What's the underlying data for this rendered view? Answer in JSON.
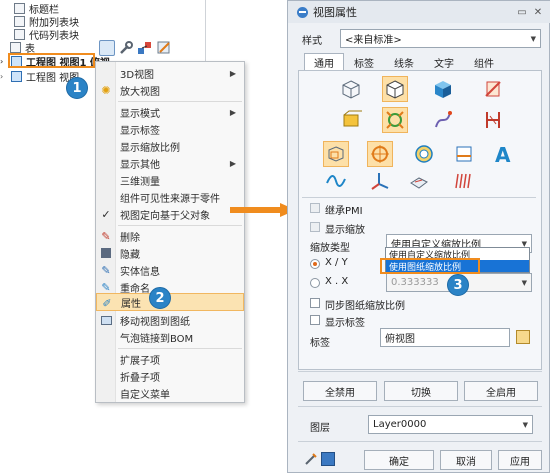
{
  "tree": {
    "items": [
      {
        "label": "标题栏"
      },
      {
        "label": "附加列表块"
      },
      {
        "label": "代码列表块"
      },
      {
        "label": "表"
      },
      {
        "label": "工程图 视图1 俯视"
      },
      {
        "label": "工程图 视图"
      }
    ]
  },
  "context_menu": {
    "items": [
      {
        "label": "3D视图",
        "submenu": true
      },
      {
        "label": "放大视图"
      },
      {
        "label": "显示模式",
        "submenu": true
      },
      {
        "label": "显示标签"
      },
      {
        "label": "显示缩放比例"
      },
      {
        "label": "显示其他",
        "submenu": true
      },
      {
        "label": "三维测量"
      },
      {
        "label": "组件可见性来源于零件"
      },
      {
        "label": "视图定向基于父对象"
      },
      {
        "label": "删除"
      },
      {
        "label": "隐藏"
      },
      {
        "label": "实体信息"
      },
      {
        "label": "重命名"
      },
      {
        "label": "属性"
      },
      {
        "label": "移动视图到图纸"
      },
      {
        "label": "气泡链接到BOM"
      },
      {
        "label": "扩展子项"
      },
      {
        "label": "折叠子项"
      },
      {
        "label": "自定义菜单"
      }
    ]
  },
  "badges": {
    "one": "1",
    "two": "2",
    "three": "3"
  },
  "dialog": {
    "title": "视图属性",
    "style_label": "样式",
    "style_value": "<来自标准>",
    "tabs": [
      "通用",
      "标签",
      "线条",
      "文字",
      "组件"
    ],
    "inherit_pmi": "继承PMI",
    "show_scale": "显示缩放",
    "scale_type_label": "缩放类型",
    "scale_type_value": "使用自定义缩放比例",
    "scale_options": [
      "使用自定义缩放比例",
      "使用图纸缩放比例"
    ],
    "radio_xy": "X / Y",
    "radio_xx": "X . X",
    "scale_decimal": "0.333333",
    "sync_scale": "同步图纸缩放比例",
    "show_label": "显示标签",
    "label_label": "标签",
    "label_value": "俯视图",
    "btn_disable_all": "全禁用",
    "btn_toggle": "切换",
    "btn_enable_all": "全启用",
    "layer_label": "图层",
    "layer_value": "Layer0000",
    "btn_ok": "确定",
    "btn_cancel": "取消",
    "btn_apply": "应用"
  },
  "colors": {
    "accent": "#f08c1e",
    "badge": "#2b83c6",
    "selection": "#1873d6",
    "highlight": "#fde0a8"
  }
}
